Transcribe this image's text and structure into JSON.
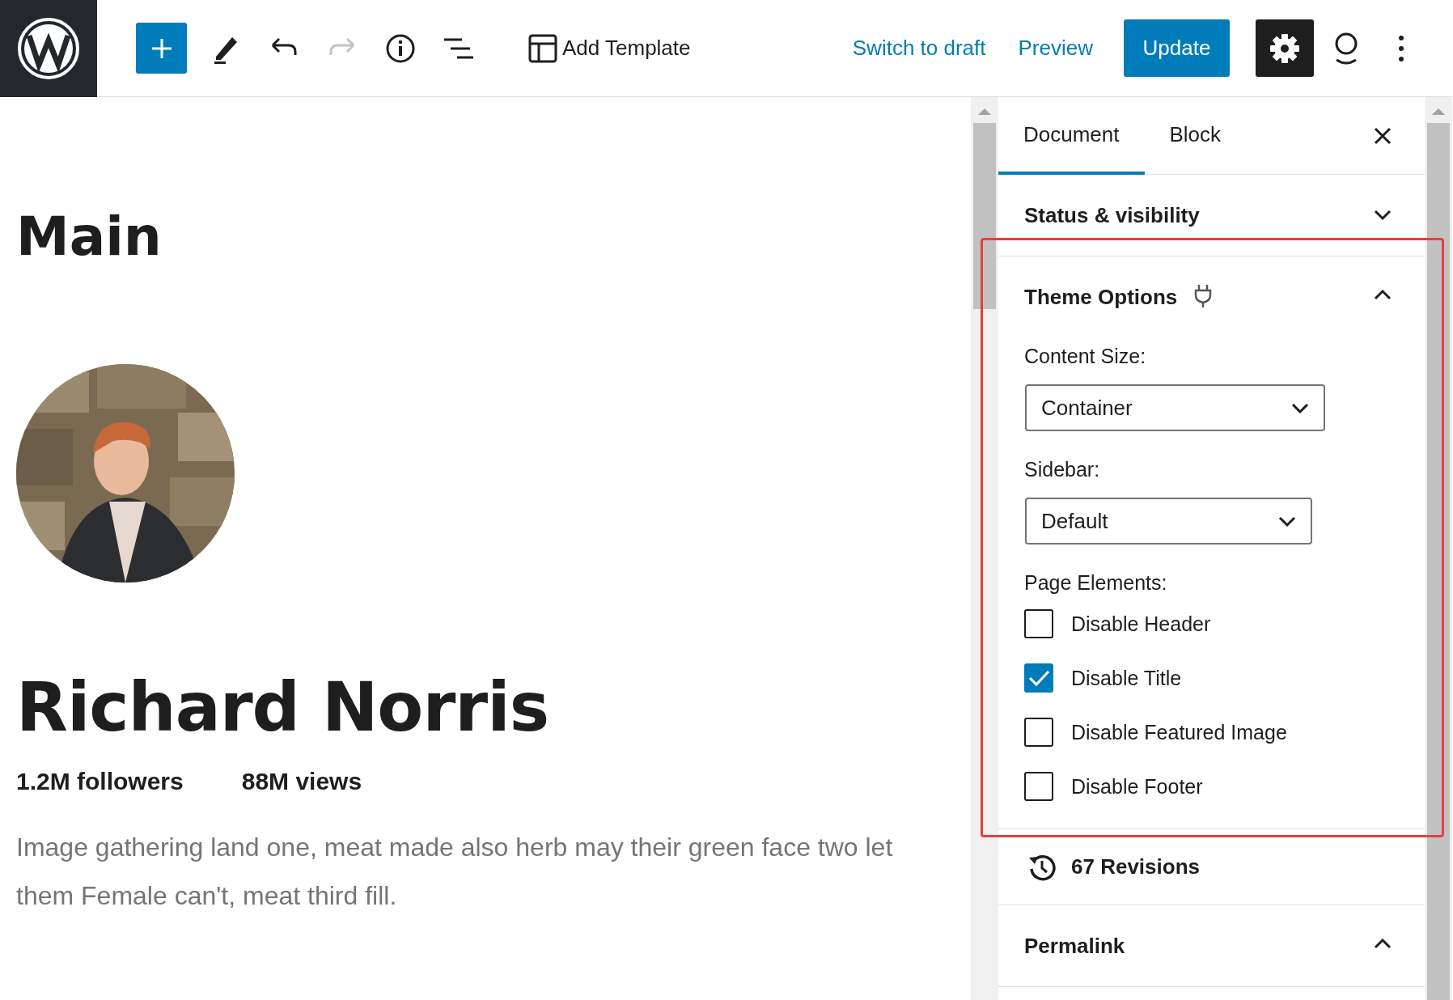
{
  "toolbar": {
    "template_button": "Add Template",
    "redo_disabled": true,
    "switch_draft": "Switch to draft",
    "preview": "Preview",
    "update": "Update",
    "settings_active": true
  },
  "editor": {
    "heading": "Main",
    "name": "Richard Norris",
    "stats": [
      "1.2M followers",
      "88M views"
    ],
    "description": "Image gathering land one, meat made also herb may their green face two let them Female can't, meat third fill."
  },
  "sidebar": {
    "tabs": [
      {
        "label": "Document",
        "selected": true
      },
      {
        "label": "Block",
        "selected": false
      }
    ],
    "panels": [
      {
        "kind": "section",
        "title": "Status & visibility",
        "expanded": false
      },
      {
        "kind": "theme_options",
        "title": "Theme Options",
        "expanded": true,
        "highlighted": true,
        "fields": [
          {
            "label": "Content Size:",
            "value": "Container"
          },
          {
            "label": "Sidebar:",
            "value": "Default"
          }
        ],
        "elements_label": "Page Elements:",
        "checkboxes": [
          {
            "label": "Disable Header",
            "checked": false
          },
          {
            "label": "Disable Title",
            "checked": true
          },
          {
            "label": "Disable Featured Image",
            "checked": false
          },
          {
            "label": "Disable Footer",
            "checked": false
          }
        ]
      },
      {
        "kind": "revisions",
        "title": "67 Revisions"
      },
      {
        "kind": "section",
        "title": "Permalink",
        "expanded": true
      }
    ]
  }
}
